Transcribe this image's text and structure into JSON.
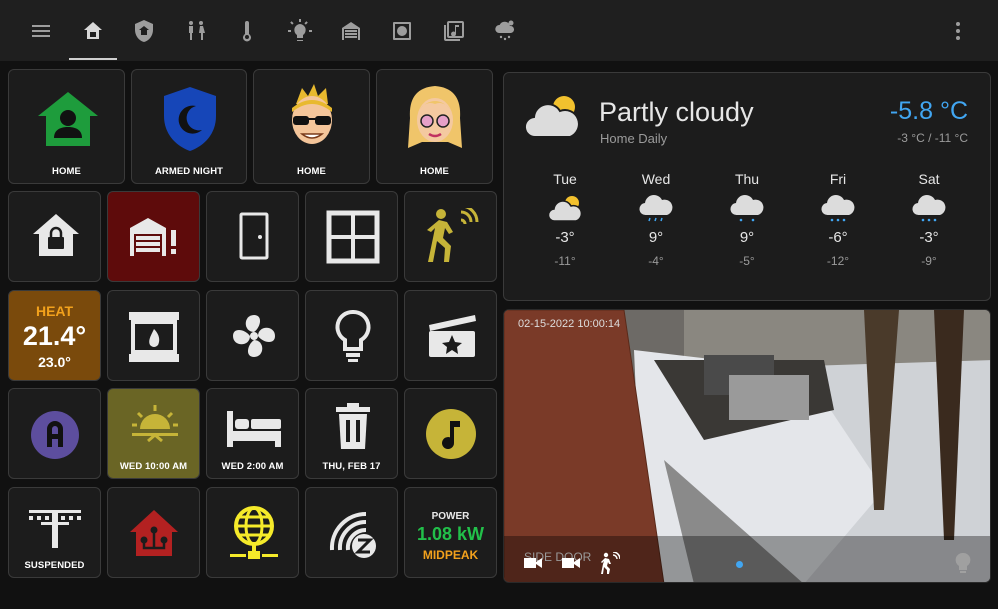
{
  "toolbar": {
    "icons": [
      "menu-icon",
      "home-view-icon",
      "shield-home-icon",
      "people-icon",
      "thermometer-icon",
      "lightbulb-icon",
      "garage-icon",
      "camera-icon",
      "music-library-icon",
      "weather-snowy-icon"
    ],
    "overflow": "more-vertical-icon"
  },
  "status_row": [
    {
      "label": "HOME",
      "icon": "home-person-icon",
      "color": "#1e9c3c"
    },
    {
      "label": "ARMED NIGHT",
      "icon": "shield-moon-icon",
      "color": "#1646b8"
    },
    {
      "label": "HOME",
      "icon": "avatar-boy-icon"
    },
    {
      "label": "HOME",
      "icon": "avatar-girl-icon"
    }
  ],
  "thermostat": {
    "mode": "HEAT",
    "current": "21.4°",
    "target": "23.0°"
  },
  "tiles": {
    "sunrise": "WED 10:00 AM",
    "bed": "WED 2:00 AM",
    "trash": "THU, FEB 17",
    "antenna": "SUSPENDED",
    "power_title": "POWER",
    "power_value": "1.08 kW",
    "power_rate": "MIDPEAK"
  },
  "weather": {
    "condition": "Partly cloudy",
    "source": "Home Daily",
    "temperature": "-5.8 °C",
    "range": "-3 °C / -11 °C",
    "forecast": [
      {
        "day": "Tue",
        "high": "-3°",
        "low": "-11°",
        "icon": "partly-cloudy"
      },
      {
        "day": "Wed",
        "high": "9°",
        "low": "-4°",
        "icon": "rainy"
      },
      {
        "day": "Thu",
        "high": "9°",
        "low": "-5°",
        "icon": "snowy"
      },
      {
        "day": "Fri",
        "high": "-6°",
        "low": "-12°",
        "icon": "snowy"
      },
      {
        "day": "Sat",
        "high": "-3°",
        "low": "-9°",
        "icon": "snowy"
      }
    ]
  },
  "camera": {
    "timestamp": "02-15-2022 10:00:14",
    "name": "SIDE DOOR"
  },
  "colors": {
    "accent_blue": "#41a6f2",
    "heat_tile": "#7a4a0c",
    "garage_alert": "#5e0b0b",
    "sunrise_tile": "#6a6525",
    "power_green": "#22c04a",
    "power_orange": "#f2a11c"
  }
}
